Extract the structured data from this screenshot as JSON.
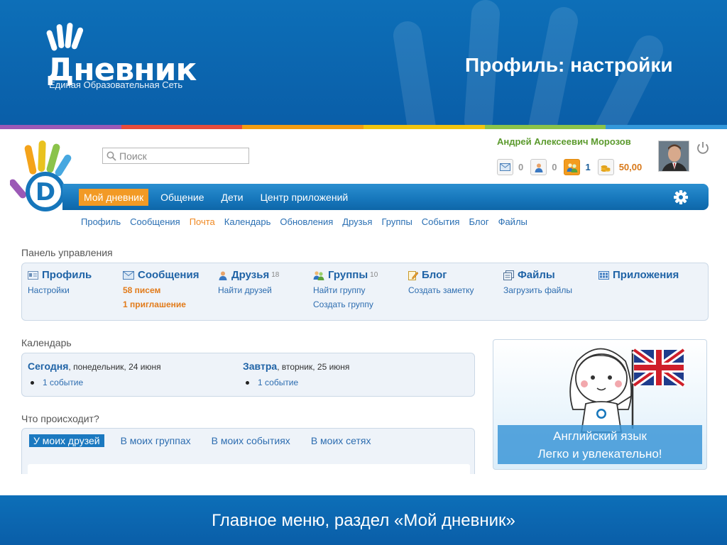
{
  "slide": {
    "brand_name": "Дневник",
    "brand_subtitle": "Единая Образовательная Сеть",
    "title": "Профиль: настройки",
    "footer": "Главное меню, раздел «Мой дневник»",
    "stripe_colors": [
      "#9b59b6",
      "#e74c3c",
      "#f39c12",
      "#f1c40f",
      "#8bc34a",
      "#3498db"
    ]
  },
  "search": {
    "placeholder": "Поиск"
  },
  "user": {
    "name": "Андрей Алексеевич Морозов",
    "counters": [
      {
        "icon": "envelope-icon",
        "value": "0"
      },
      {
        "icon": "person-icon",
        "value": "0"
      },
      {
        "icon": "group-icon",
        "value": "1"
      },
      {
        "icon": "coins-icon",
        "value": "50,00"
      }
    ]
  },
  "main_nav": {
    "items": [
      "Мой дневник",
      "Общение",
      "Дети",
      "Центр приложений"
    ],
    "active": "Мой дневник"
  },
  "sub_nav": {
    "items": [
      "Профиль",
      "Сообщения",
      "Почта",
      "Календарь",
      "Обновления",
      "Друзья",
      "Группы",
      "События",
      "Блог",
      "Файлы"
    ],
    "current": "Почта"
  },
  "control_panel": {
    "title": "Панель управления",
    "columns": [
      {
        "title": "Профиль",
        "icon": "profile-card-icon",
        "links": [
          "Настройки"
        ]
      },
      {
        "title": "Сообщения",
        "icon": "envelope-icon",
        "links": [
          "58 писем",
          "1 приглашение"
        ]
      },
      {
        "title": "Друзья",
        "icon": "person-icon",
        "count": "18",
        "links": [
          "Найти друзей"
        ]
      },
      {
        "title": "Группы",
        "icon": "group-icon",
        "count": "10",
        "links": [
          "Найти группу",
          "Создать группу"
        ]
      },
      {
        "title": "Блог",
        "icon": "pencil-icon",
        "links": [
          "Создать заметку"
        ]
      },
      {
        "title": "Файлы",
        "icon": "files-icon",
        "links": [
          "Загрузить файлы"
        ]
      },
      {
        "title": "Приложения",
        "icon": "apps-icon",
        "links": []
      }
    ]
  },
  "calendar": {
    "title": "Календарь",
    "today_label": "Сегодня",
    "today_date": ", понедельник, 24 июня",
    "today_event": "1 событие",
    "tomorrow_label": "Завтра",
    "tomorrow_date": ", вторник, 25 июня",
    "tomorrow_event": "1 событие"
  },
  "feed": {
    "title": "Что происходит?",
    "tabs": [
      "У моих друзей",
      "В моих группах",
      "В моих событиях",
      "В моих сетях"
    ],
    "active_tab": "У моих друзей"
  },
  "promo": {
    "line1": "Английский язык",
    "line2": "Легко и увлекательно!"
  }
}
